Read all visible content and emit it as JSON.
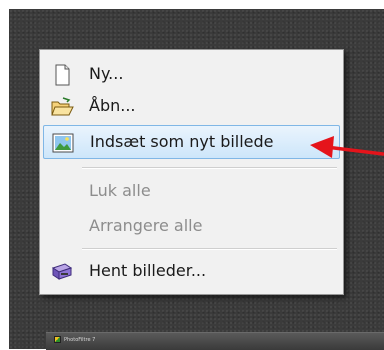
{
  "taskbar": {
    "app_title": "PhotoFiltre 7"
  },
  "menu": {
    "items": [
      {
        "label": "Ny...",
        "icon": "new-document-icon",
        "enabled": true
      },
      {
        "label": "Åbn...",
        "icon": "open-folder-icon",
        "enabled": true
      },
      {
        "label": "Indsæt som nyt billede",
        "icon": "paste-image-icon",
        "enabled": true,
        "highlighted": true
      },
      {
        "label": "Luk alle",
        "enabled": false
      },
      {
        "label": "Arrangere alle",
        "enabled": false
      },
      {
        "label": "Hent billeder...",
        "icon": "scanner-icon",
        "enabled": true
      }
    ]
  },
  "annotation": {
    "arrow_color": "#e5141b",
    "pointer": "red-arrow-icon"
  },
  "colors": {
    "highlight_border": "#80b7e6",
    "background": "#3b3b3b"
  }
}
